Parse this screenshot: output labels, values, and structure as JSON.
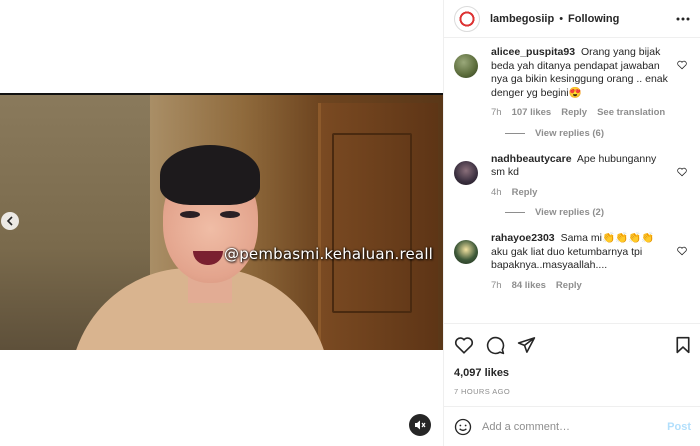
{
  "media": {
    "watermark": "@pembasmi.kehaluan.reall"
  },
  "header": {
    "username": "lambegosiip",
    "separator": "•",
    "follow_status": "Following",
    "more": "..."
  },
  "comments": [
    {
      "username": "alicee_puspita93",
      "text": "Orang yang bijak beda yah ditanya pendapat jawaban nya ga bikin kesinggung orang .. enak denger yg begini😍",
      "time": "7h",
      "likes": "107 likes",
      "reply": "Reply",
      "extra": "See translation",
      "avatar_color": "#5a6b3a",
      "view_replies": "View replies (6)"
    },
    {
      "username": "nadhbeautycare",
      "text": "Ape hubunganny sm kd",
      "time": "4h",
      "likes": "",
      "reply": "Reply",
      "extra": "",
      "avatar_color": "#3a2f3f",
      "view_replies": "View replies (2)"
    },
    {
      "username": "rahayoe2303",
      "text": "Sama mi👏👏👏👏 aku gak liat duo ketumbarnya tpi bapaknya..masyaallah....",
      "time": "7h",
      "likes": "84 likes",
      "reply": "Reply",
      "extra": "",
      "avatar_color": "#3f5a3a",
      "view_replies": ""
    }
  ],
  "post": {
    "likes": "4,097 likes",
    "time": "7 HOURS AGO"
  },
  "add_comment": {
    "placeholder": "Add a comment…",
    "post_label": "Post"
  },
  "icons": [
    "chevron-left-icon",
    "mute-icon",
    "heart-icon",
    "comment-icon",
    "share-icon",
    "bookmark-icon",
    "emoji-icon",
    "more-icon"
  ]
}
